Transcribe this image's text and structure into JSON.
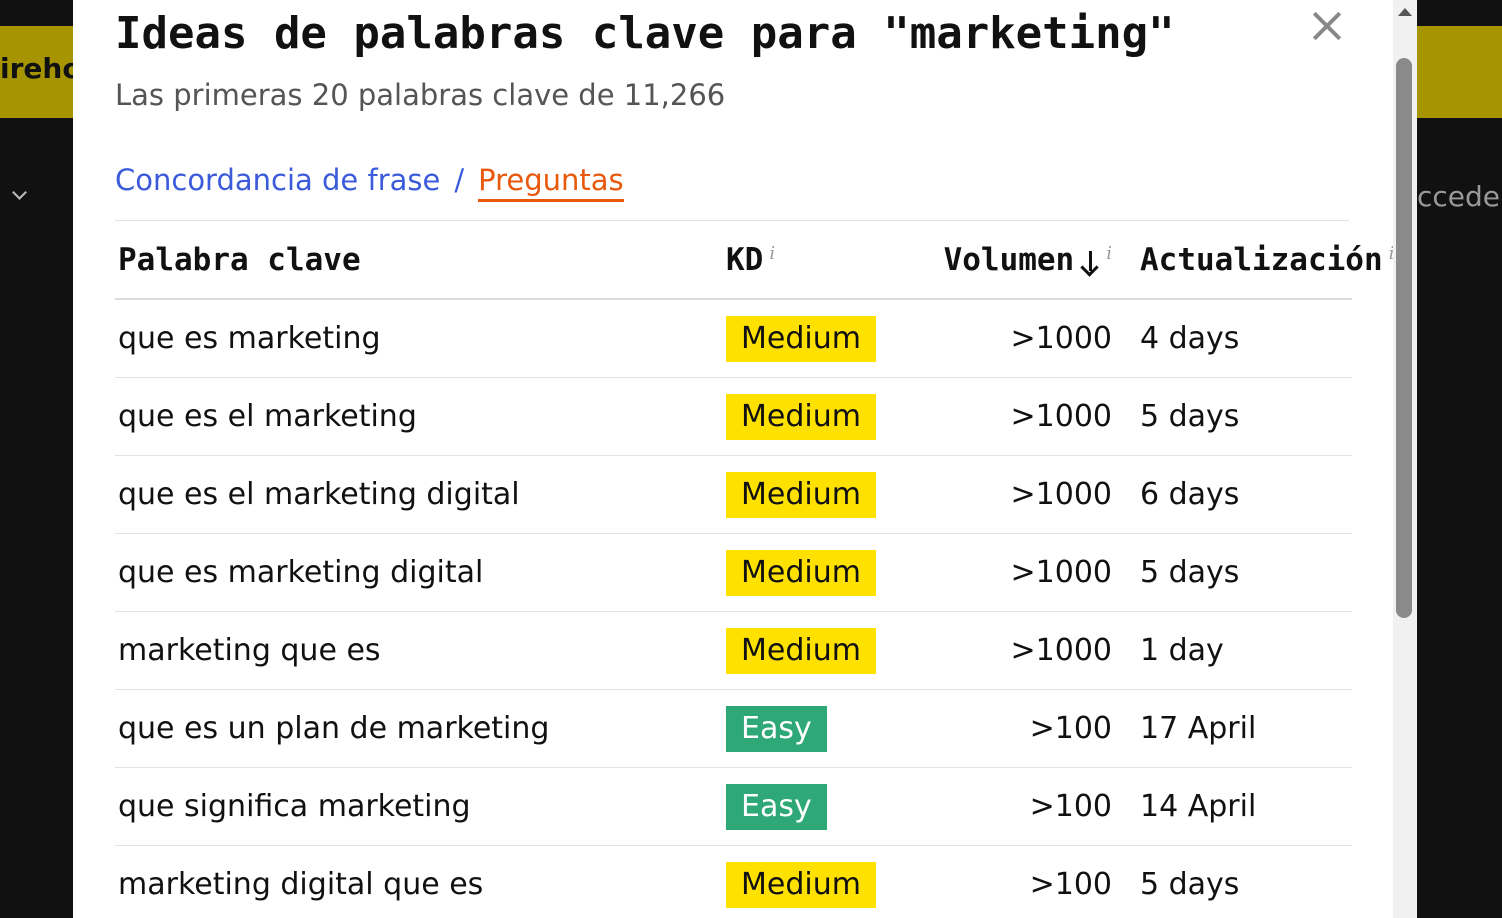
{
  "background": {
    "left_text": "ireho",
    "right_text": "cceder"
  },
  "modal": {
    "title": "Ideas de palabras clave para \"marketing\"",
    "subtitle": "Las primeras 20 palabras clave de 11,266",
    "tabs": [
      {
        "label": "Concordancia de frase",
        "active": false
      },
      {
        "label": "Preguntas",
        "active": true
      }
    ],
    "tab_separator": "/"
  },
  "table": {
    "headers": {
      "keyword": "Palabra clave",
      "kd": "KD",
      "volume": "Volumen",
      "updated": "Actualización",
      "info": "i"
    },
    "rows": [
      {
        "keyword": "que es marketing",
        "kd": "Medium",
        "volume": ">1000",
        "updated": "4 days"
      },
      {
        "keyword": "que es el marketing",
        "kd": "Medium",
        "volume": ">1000",
        "updated": "5 days"
      },
      {
        "keyword": "que es el marketing digital",
        "kd": "Medium",
        "volume": ">1000",
        "updated": "6 days"
      },
      {
        "keyword": "que es marketing digital",
        "kd": "Medium",
        "volume": ">1000",
        "updated": "5 days"
      },
      {
        "keyword": "marketing que es",
        "kd": "Medium",
        "volume": ">1000",
        "updated": "1 day"
      },
      {
        "keyword": "que es un plan de marketing",
        "kd": "Easy",
        "volume": ">100",
        "updated": "17 April"
      },
      {
        "keyword": "que significa marketing",
        "kd": "Easy",
        "volume": ">100",
        "updated": "14 April"
      },
      {
        "keyword": "marketing digital que es",
        "kd": "Medium",
        "volume": ">100",
        "updated": "5 days"
      }
    ]
  },
  "colors": {
    "medium_badge": "#ffe100",
    "easy_badge": "#2ea876",
    "link": "#3b5bdb",
    "active_tab": "#e8590c"
  }
}
